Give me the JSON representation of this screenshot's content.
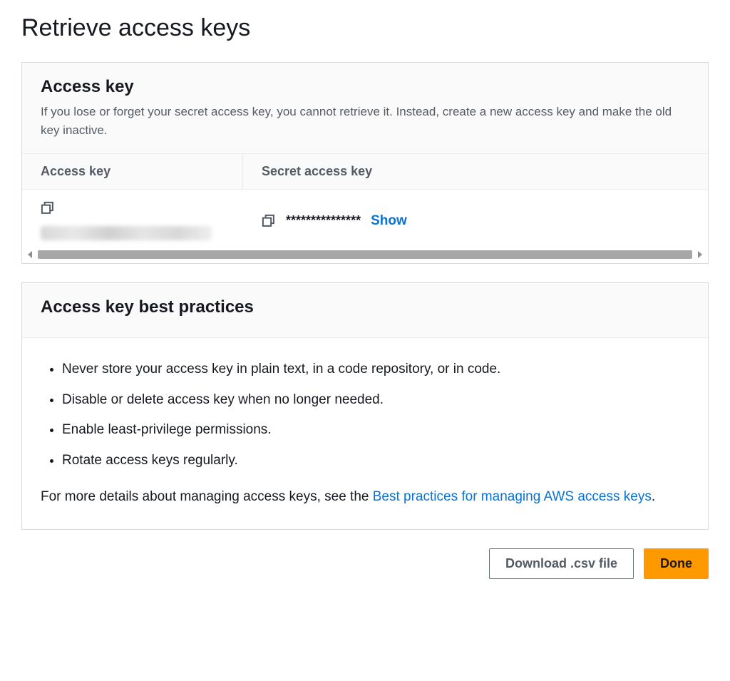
{
  "page": {
    "title": "Retrieve access keys"
  },
  "access_key_panel": {
    "heading": "Access key",
    "description": "If you lose or forget your secret access key, you cannot retrieve it. Instead, create a new access key and make the old key inactive.",
    "columns": {
      "access_key": "Access key",
      "secret_key": "Secret access key"
    },
    "row": {
      "secret_masked": "***************",
      "show_label": "Show"
    }
  },
  "best_practices_panel": {
    "heading": "Access key best practices",
    "items": [
      "Never store your access key in plain text, in a code repository, or in code.",
      "Disable or delete access key when no longer needed.",
      "Enable least-privilege permissions.",
      "Rotate access keys regularly."
    ],
    "more_prefix": "For more details about managing access keys, see the ",
    "more_link": "Best practices for managing AWS access keys",
    "more_suffix": "."
  },
  "buttons": {
    "download": "Download .csv file",
    "done": "Done"
  }
}
